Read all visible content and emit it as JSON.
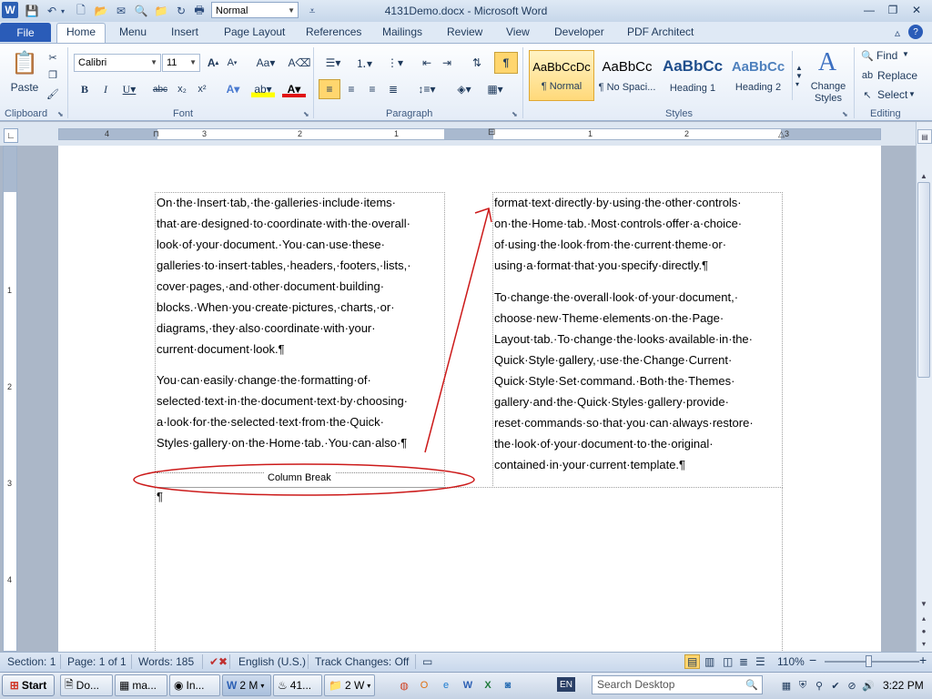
{
  "window": {
    "title": "4131Demo.docx - Microsoft Word",
    "app_icon": "W",
    "quick_style": "Normal",
    "minimize": "—",
    "restore": "❐",
    "close": "✕"
  },
  "tabs": {
    "file": "File",
    "home": "Home",
    "menu": "Menu",
    "insert": "Insert",
    "page_layout": "Page Layout",
    "references": "References",
    "mailings": "Mailings",
    "review": "Review",
    "view": "View",
    "developer": "Developer",
    "pdf_architect": "PDF Architect"
  },
  "ribbon": {
    "clipboard": {
      "label": "Clipboard",
      "paste": "Paste"
    },
    "font": {
      "label": "Font",
      "font_name": "Calibri",
      "font_size": "11"
    },
    "paragraph": {
      "label": "Paragraph",
      "pilcrow": "¶"
    },
    "styles": {
      "label": "Styles",
      "items": [
        {
          "preview": "AaBbCcDc",
          "name": "¶ Normal"
        },
        {
          "preview": "AaBbCc",
          "name": "¶ No Spaci..."
        },
        {
          "preview": "AaBbCc",
          "name": "Heading 1"
        },
        {
          "preview": "AaBbCc",
          "name": "Heading 2"
        }
      ],
      "change_styles_line1": "Change",
      "change_styles_line2": "Styles"
    },
    "editing": {
      "label": "Editing",
      "find": "Find",
      "replace": "Replace",
      "select": "Select"
    }
  },
  "ruler": {
    "numbers": [
      "4",
      "3",
      "2",
      "1",
      "1",
      "2",
      "3"
    ]
  },
  "vruler": {
    "numbers": [
      "1",
      "2",
      "3",
      "4"
    ]
  },
  "document": {
    "col1_p1": [
      "On·the·Insert·tab,·the·galleries·include·items·",
      "that·are·designed·to·coordinate·with·the·overall·",
      "look·of·your·document.·You·can·use·these·",
      "galleries·to·insert·tables,·headers,·footers,·lists,·",
      "cover·pages,·and·other·document·building·",
      "blocks.·When·you·create·pictures,·charts,·or·",
      "diagrams,·they·also·coordinate·with·your·",
      "current·document·look.¶"
    ],
    "col1_p2": [
      "You·can·easily·change·the·formatting·of·",
      "selected·text·in·the·document·text·by·choosing·",
      "a·look·for·the·selected·text·from·the·Quick·",
      "Styles·gallery·on·the·Home·tab.·You·can·also·¶"
    ],
    "column_break": "Column Break",
    "after_break": "¶",
    "col2_p1": [
      "format·text·directly·by·using·the·other·controls·",
      "on·the·Home·tab.·Most·controls·offer·a·choice·",
      "of·using·the·look·from·the·current·theme·or·",
      "using·a·format·that·you·specify·directly.¶"
    ],
    "col2_p2": [
      "To·change·the·overall·look·of·your·document,·",
      "choose·new·Theme·elements·on·the·Page·",
      "Layout·tab.·To·change·the·looks·available·in·the·",
      "Quick·Style·gallery,·use·the·Change·Current·",
      "Quick·Style·Set·command.·Both·the·Themes·",
      "gallery·and·the·Quick·Styles·gallery·provide·",
      "reset·commands·so·that·you·can·always·restore·",
      "the·look·of·your·document·to·the·original·",
      "contained·in·your·current·template.¶"
    ]
  },
  "status": {
    "section": "Section: 1",
    "page": "Page: 1 of 1",
    "words": "Words: 185",
    "language": "English (U.S.)",
    "track_changes": "Track Changes: Off",
    "zoom": "110%",
    "zoom_minus": "−",
    "zoom_plus": "+"
  },
  "taskbar": {
    "start": "Start",
    "items": [
      "Do...",
      "ma...",
      "In...",
      "2 M",
      "41...",
      "2 W"
    ],
    "search_placeholder": "Search Desktop",
    "lang": "EN",
    "clock": "3:22 PM"
  },
  "colors": {
    "accent": "#2a5cb8",
    "annotation": "#cc1a1a"
  }
}
